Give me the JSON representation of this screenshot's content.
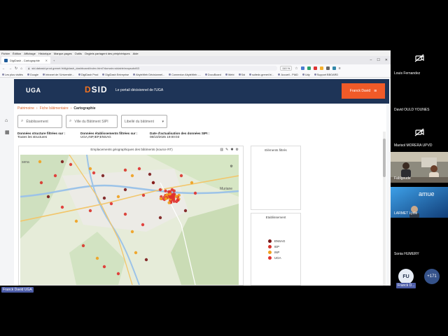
{
  "browser": {
    "menu": [
      "Fichier",
      "Édition",
      "Affichage",
      "Historique",
      "Marque-pages",
      "Outils",
      "Onglets partagent des périphériques",
      "Aide"
    ],
    "tab_title": "DigiDash - Cartographie",
    "url": "sid-datasid-prod.grenet.fr/digidash_dashboard/index.html?domain=sidairie/mapsub#63",
    "zoom": "110 %",
    "bookmarks": [
      "Les plus visités",
      "Google",
      "Intranet de l'Université...",
      "DigiDash Prod",
      "DigiDash Entreprise",
      "AbyleWeb Décisionnel...",
      "Connexion AbyleWeb -...",
      "DocuBoard",
      "Webi",
      "Sid",
      "suitedx.grenet.fr/...",
      "Accueil - PIAD",
      "Udy",
      "Support BBOARD"
    ]
  },
  "app": {
    "logo": "UGA",
    "brand_prefix": "D",
    "brand_suffix": "SID",
    "tagline": "Le portail décisionnel de l'UGA",
    "user": "Franck David",
    "rail_icons": [
      "home-icon",
      "building-icon"
    ]
  },
  "breadcrumb": {
    "item1": "Patrimoine",
    "item2": "Fiche bâtimentaire",
    "current": "Cartographie"
  },
  "filters": {
    "etablissement": "Établissement",
    "ville": "Ville du Bâtiment SIPI",
    "libelle": "Libellé du bâtiment"
  },
  "info": {
    "structures_label": "Données structure filtrées sur :",
    "structures_value": "Toutes les structures",
    "etab_label": "Données établissements filtrées sur :",
    "etab_value": "UGA,INP,IEP,ENSAG",
    "date_label": "Date d'actualisation des données SIPI :",
    "date_value": "08/10/2025 19:00:03"
  },
  "map": {
    "title": "Emplacements géographiques des bâtiments (source RT)",
    "label_left": "sena",
    "label_right": "Muriane"
  },
  "panels": {
    "filtered": "Eléments filtrés",
    "legend_title": "Etablissement",
    "legend": [
      {
        "label": "ENSAG",
        "color": "#7a1a1a"
      },
      {
        "label": "IEP",
        "color": "#d9342b"
      },
      {
        "label": "INP",
        "color": "#f0a01e"
      },
      {
        "label": "UGA",
        "color": "#e0312f"
      }
    ]
  },
  "participants": {
    "p1": "Louis Fernandez",
    "p2": "David OULD YOUNES",
    "p3": "Marisol MORERA UPVD",
    "p4": "Fablgoude",
    "p5": "LARMET Lydie",
    "p6": "Sonia HUMERY",
    "initials": "FU",
    "self_tag": "Franck D...",
    "more": "+171",
    "presenter": "Franck David UGA",
    "amue": "amue"
  }
}
